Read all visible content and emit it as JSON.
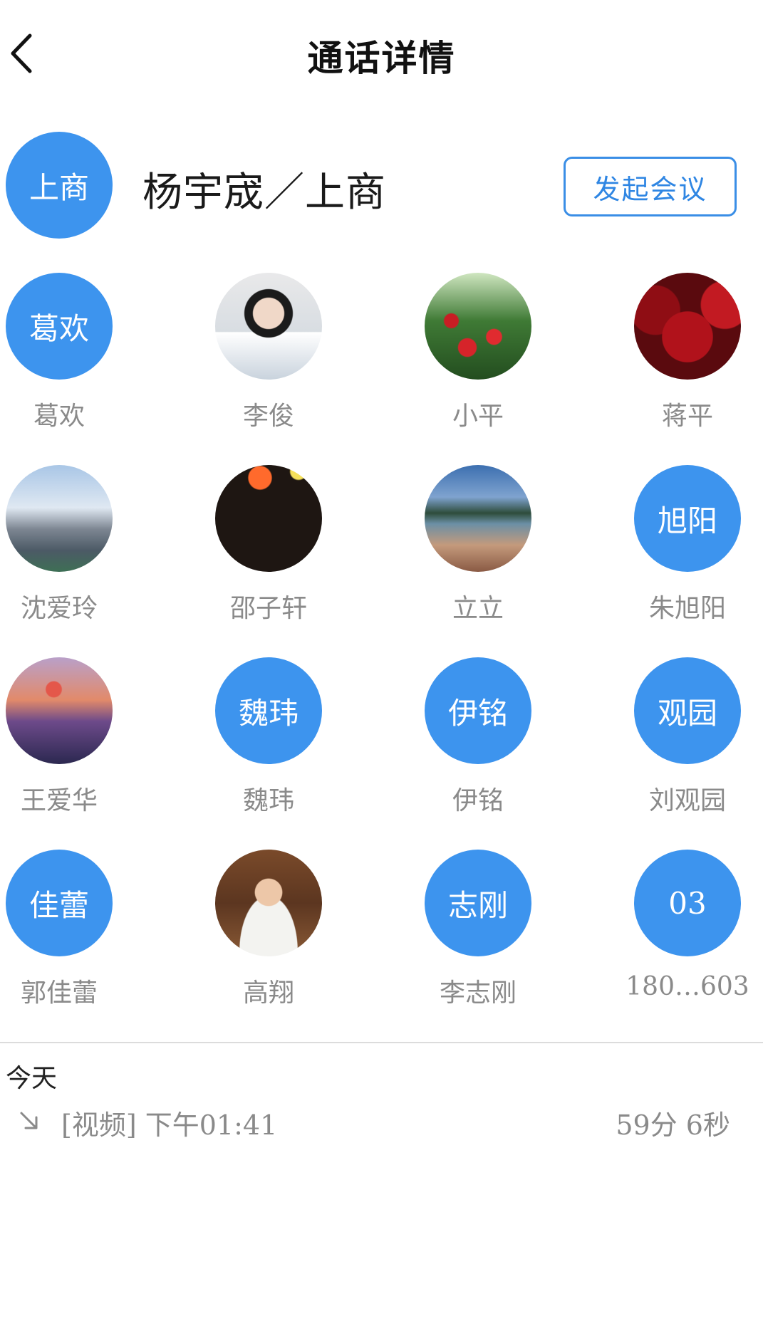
{
  "nav": {
    "title": "通话详情"
  },
  "header": {
    "group_avatar_text": "上商",
    "group_name": "杨宇宬／上商",
    "start_meeting_label": "发起会议"
  },
  "members": [
    {
      "name": "葛欢",
      "avatar_text": "葛欢",
      "avatar_type": "text"
    },
    {
      "name": "李俊",
      "avatar_text": "",
      "avatar_type": "photo-portrait"
    },
    {
      "name": "小平",
      "avatar_text": "",
      "avatar_type": "photo-roses"
    },
    {
      "name": "蒋平",
      "avatar_text": "",
      "avatar_type": "photo-cherries"
    },
    {
      "name": "沈爱玲",
      "avatar_text": "",
      "avatar_type": "photo-castle"
    },
    {
      "name": "邵子轩",
      "avatar_text": "",
      "avatar_type": "photo-lantern"
    },
    {
      "name": "立立",
      "avatar_text": "",
      "avatar_type": "photo-lake"
    },
    {
      "name": "朱旭阳",
      "avatar_text": "旭阳",
      "avatar_type": "text"
    },
    {
      "name": "王爱华",
      "avatar_text": "",
      "avatar_type": "photo-bridge"
    },
    {
      "name": "魏玮",
      "avatar_text": "魏玮",
      "avatar_type": "text"
    },
    {
      "name": "伊铭",
      "avatar_text": "伊铭",
      "avatar_type": "text"
    },
    {
      "name": "刘观园",
      "avatar_text": "观园",
      "avatar_type": "text"
    },
    {
      "name": "郭佳蕾",
      "avatar_text": "佳蕾",
      "avatar_type": "text"
    },
    {
      "name": "高翔",
      "avatar_text": "",
      "avatar_type": "photo-man"
    },
    {
      "name": "李志刚",
      "avatar_text": "志刚",
      "avatar_type": "text"
    },
    {
      "name": "180…603",
      "avatar_text": "03",
      "avatar_type": "text"
    }
  ],
  "history": {
    "day_label": "今天",
    "calls": [
      {
        "direction_icon": "incoming-arrow-icon",
        "description": "[视频] 下午01:41",
        "duration": "59分  6秒"
      }
    ]
  },
  "colors": {
    "accent": "#3d94ee",
    "button_border": "#3a8ee6",
    "muted_text": "#8a8a8a"
  }
}
